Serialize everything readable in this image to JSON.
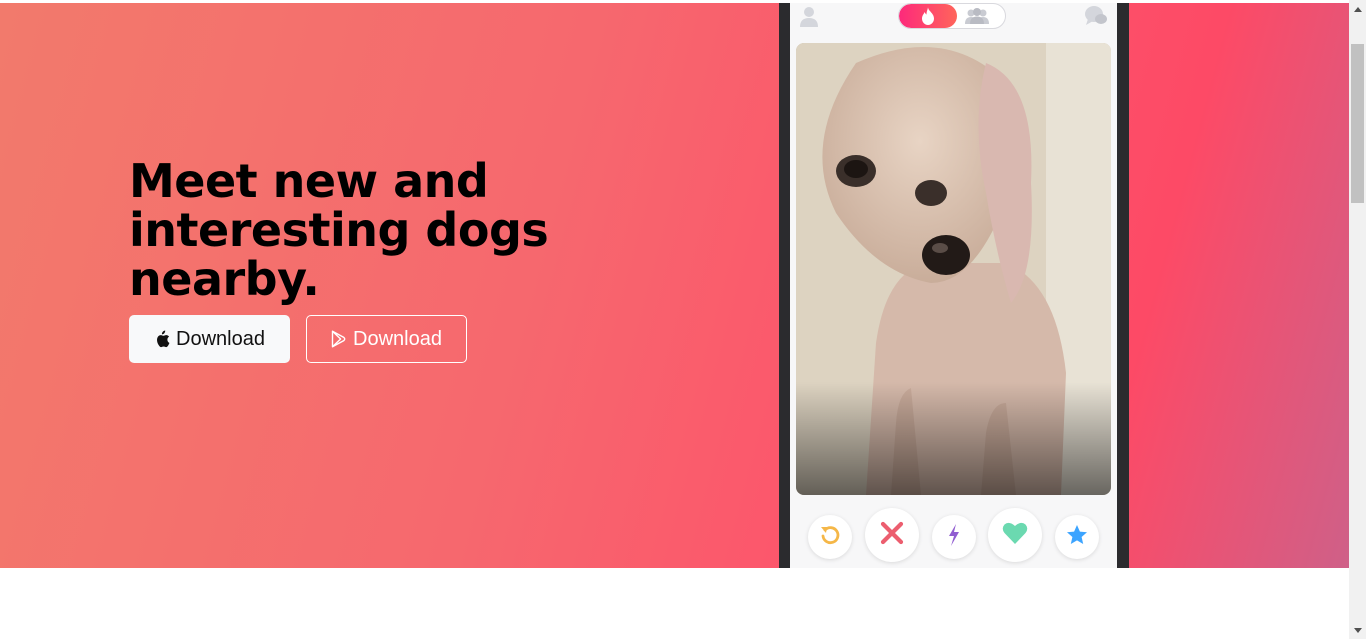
{
  "hero": {
    "headline": "Meet new and interesting dogs nearby.",
    "buttons": {
      "apple_label": "Download",
      "play_label": "Download"
    }
  },
  "phone": {
    "icons": [
      "user-icon",
      "flame-icon",
      "group-icon",
      "chat-icon"
    ],
    "card": {
      "image": "dog-photo"
    },
    "actions": [
      "undo-icon",
      "nope-icon",
      "boost-icon",
      "like-icon",
      "super-like-icon"
    ]
  },
  "colors": {
    "gradient_start": "#f27a6c",
    "gradient_end": "#fd4a66",
    "undo": "#f5b748",
    "nope": "#ec5e6f",
    "boost": "#915dd1",
    "like": "#6bd9b0",
    "super_like": "#3ca4ff"
  }
}
